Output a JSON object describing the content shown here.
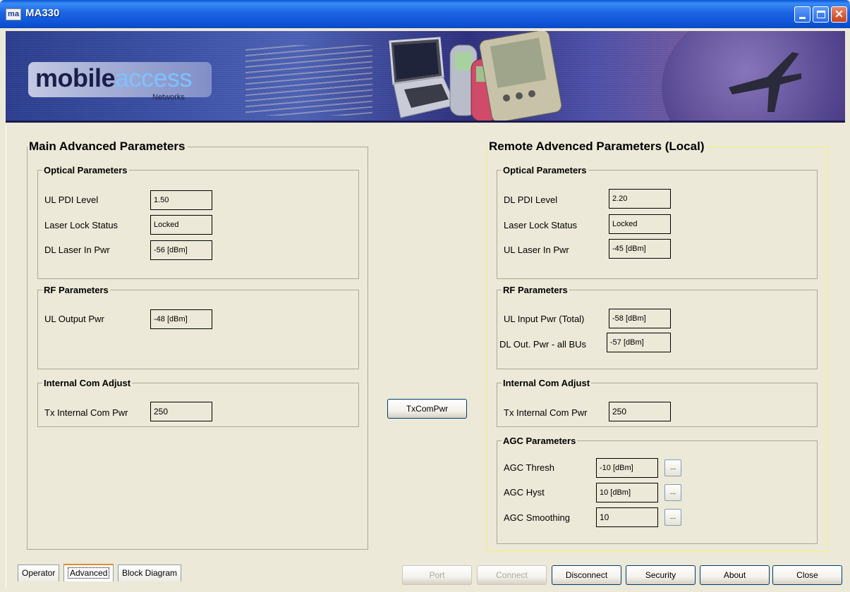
{
  "window": {
    "icon_text": "ma",
    "title": "MA330",
    "minimize_icon": "minimize-icon",
    "maximize_icon": "maximize-icon",
    "close_icon": "close-icon"
  },
  "banner": {
    "logo_main": "mobile",
    "logo_accent": "access",
    "logo_sub": "Networks"
  },
  "main_panel": {
    "title": "Main Advanced Parameters",
    "optical": {
      "title": "Optical Parameters",
      "rows": [
        {
          "label": "UL PDI Level",
          "value": "1.50"
        },
        {
          "label": "Laser Lock Status",
          "value": "Locked"
        },
        {
          "label": "DL Laser In Pwr",
          "value": "-56 [dBm]"
        }
      ]
    },
    "rf": {
      "title": "RF Parameters",
      "rows": [
        {
          "label": "UL Output Pwr",
          "value": "-48 [dBm]"
        }
      ]
    },
    "internal_com": {
      "title": "Internal Com Adjust",
      "label": "Tx Internal Com Pwr",
      "value": "250"
    }
  },
  "middle": {
    "txcompwr_label": "TxComPwr"
  },
  "remote_panel": {
    "title": "Remote Advenced Parameters (Local)",
    "optical": {
      "title": "Optical Parameters",
      "rows": [
        {
          "label": "DL PDI Level",
          "value": "2.20"
        },
        {
          "label": "Laser Lock Status",
          "value": "Locked"
        },
        {
          "label": "UL Laser In Pwr",
          "value": "-45 [dBm]"
        }
      ]
    },
    "rf": {
      "title": "RF Parameters",
      "rows": [
        {
          "label": "UL Input Pwr (Total)",
          "value": "-58 [dBm]"
        },
        {
          "label": "DL Out. Pwr - all BUs",
          "value": "-57 [dBm]"
        }
      ]
    },
    "internal_com": {
      "title": "Internal Com Adjust",
      "label": "Tx Internal Com Pwr",
      "value": "250"
    },
    "agc": {
      "title": "AGC Parameters",
      "rows": [
        {
          "label": "AGC Thresh",
          "value": "-10 [dBm]",
          "button": "..."
        },
        {
          "label": "AGC Hyst",
          "value": "10 [dBm]",
          "button": "..."
        },
        {
          "label": "AGC Smoothing",
          "value": "10",
          "button": "..."
        }
      ]
    }
  },
  "tabs": [
    {
      "label": "Operator",
      "active": false
    },
    {
      "label": "Advanced",
      "active": true
    },
    {
      "label": "Block Diagram",
      "active": false
    }
  ],
  "bottom_buttons": {
    "port": "Port",
    "connect": "Connect",
    "disconnect": "Disconnect",
    "security": "Security",
    "about": "About",
    "close": "Close"
  },
  "colors": {
    "titlebar": "#0a57d6",
    "remote_panel_border": "#f4f07a",
    "tab_highlight": "#e68b2c",
    "window_bg": "#ece9d8"
  }
}
